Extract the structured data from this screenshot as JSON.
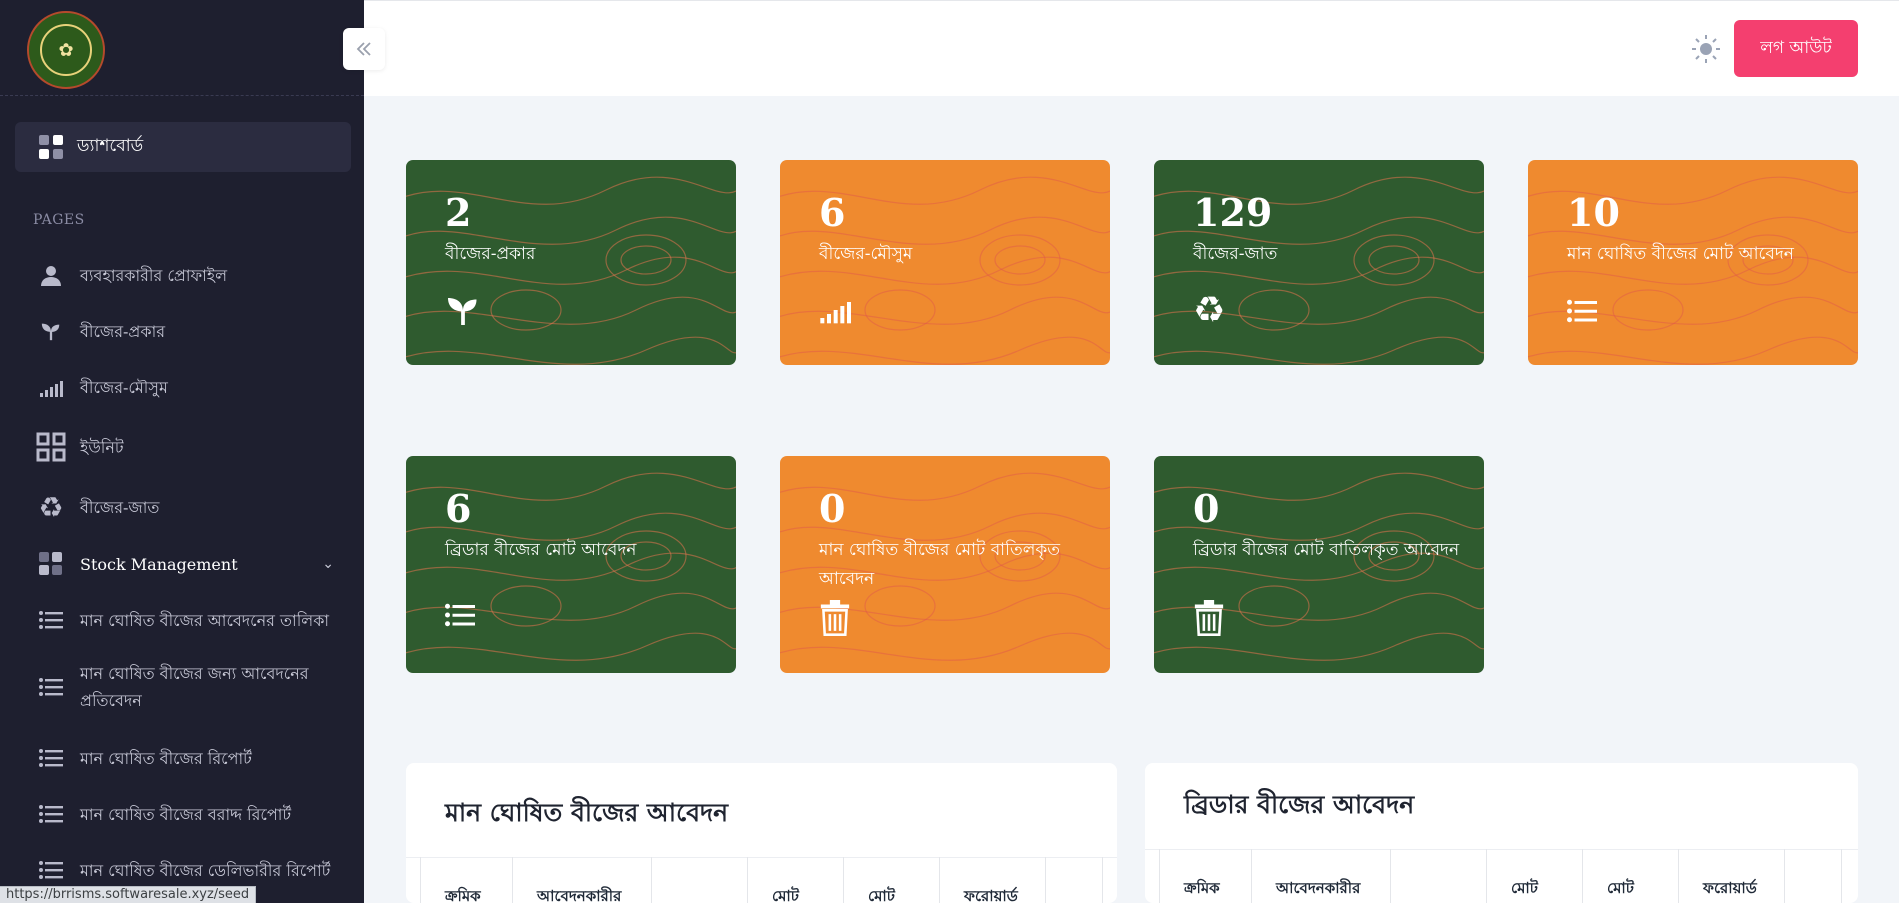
{
  "sidebar": {
    "dashboard_label": "ড্যাশবোর্ড",
    "pages_title": "PAGES",
    "items": [
      {
        "label": "ব্যবহারকারীর প্রোফাইল",
        "icon": "user-icon"
      },
      {
        "label": "বীজের-প্রকার",
        "icon": "seedling-icon"
      },
      {
        "label": "বীজের-মৌসুম",
        "icon": "signal-bars-icon"
      },
      {
        "label": "ইউনিট",
        "icon": "grid-icon"
      },
      {
        "label": "বীজের-জাত",
        "icon": "recycle-icon"
      },
      {
        "label": "Stock Management",
        "icon": "dashboard-icon"
      },
      {
        "label": "মান ঘোষিত বীজের আবেদনের তালিকা",
        "icon": "list-icon"
      },
      {
        "label": "মান ঘোষিত বীজের জন্য আবেদনের প্রতিবেদন",
        "icon": "list-icon"
      },
      {
        "label": "মান ঘোষিত বীজের রিপোর্ট",
        "icon": "list-icon"
      },
      {
        "label": "মান ঘোষিত বীজের বরাদ্দ রিপোর্ট",
        "icon": "list-icon"
      },
      {
        "label": "মান ঘোষিত বীজের ডেলিভারীর রিপোর্ট",
        "icon": "list-icon"
      }
    ],
    "status_url": "https://brrisms.softwaresale.xyz/seed"
  },
  "header": {
    "logout_label": "লগ আউট",
    "theme_icon": "sun-icon"
  },
  "cards": [
    {
      "value": "2",
      "label": "বীজের-প্রকার",
      "color": "#2f5b2f",
      "icon": "seedling-icon"
    },
    {
      "value": "6",
      "label": "বীজের-মৌসুম",
      "color": "#ef8a2f",
      "icon": "signal-bars-icon"
    },
    {
      "value": "129",
      "label": "বীজের-জাত",
      "color": "#2f5b2f",
      "icon": "recycle-icon"
    },
    {
      "value": "10",
      "label": "মান ঘোষিত বীজের মোট আবেদন",
      "color": "#ef8a2f",
      "icon": "list-icon"
    },
    {
      "value": "6",
      "label": "ব্রিডার বীজের মোট আবেদন",
      "color": "#2f5b2f",
      "icon": "list-icon"
    },
    {
      "value": "0",
      "label": "মান ঘোষিত বীজের মোট বাতিলকৃত আবেদন",
      "color": "#ef8a2f",
      "icon": "trash-icon"
    },
    {
      "value": "0",
      "label": "ব্রিডার বীজের মোট বাতিলকৃত আবেদন",
      "color": "#2f5b2f",
      "icon": "trash-icon"
    }
  ],
  "tables": [
    {
      "title": "মান ঘোষিত বীজের আবেদন",
      "columns": [
        "ক্রমিক",
        "আবেদনকারীর",
        "",
        "মোট",
        "মোট",
        "ফরোয়ার্ড",
        ""
      ]
    },
    {
      "title": "ব্রিডার বীজের আবেদন",
      "columns": [
        "ক্রমিক",
        "আবেদনকারীর",
        "",
        "মোট",
        "মোট",
        "ফরোয়ার্ড",
        ""
      ]
    }
  ]
}
